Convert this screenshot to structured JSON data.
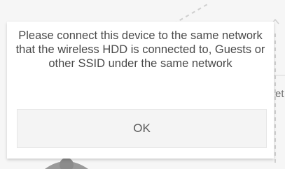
{
  "background": {
    "partial_label": "et"
  },
  "dialog": {
    "message": "Please connect this device to the same network that the wireless HDD is connected to, Guests or other SSID under the same network",
    "ok_label": "OK"
  },
  "colors": {
    "dialog_background": "#ffffff",
    "button_background": "#f4f4f4",
    "text": "#4a4a4a"
  }
}
